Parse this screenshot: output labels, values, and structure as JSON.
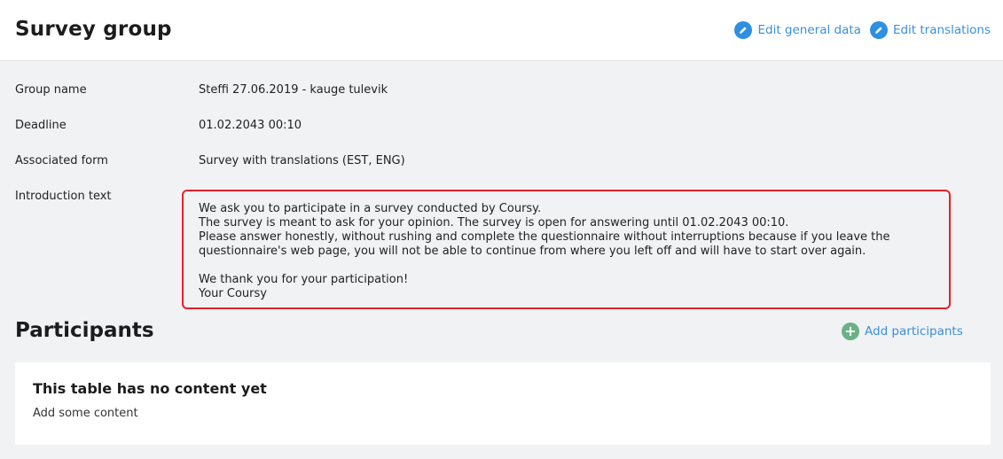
{
  "header": {
    "title": "Survey group",
    "edit_general_label": "Edit general data",
    "edit_translations_label": "Edit translations"
  },
  "details": [
    {
      "label": "Group name",
      "value": "Steffi 27.06.2019 - kauge tulevik"
    },
    {
      "label": "Deadline",
      "value": "01.02.2043 00:10"
    },
    {
      "label": "Associated form",
      "value": "Survey with translations (EST, ENG)"
    },
    {
      "label": "Introduction text",
      "value": ""
    }
  ],
  "intro": {
    "line1": "We ask you to participate in a survey conducted by Coursy.",
    "line2": "The survey is meant to ask for your opinion. The survey is open for answering until 01.02.2043 00:10.",
    "line3": "Please answer honestly, without rushing and complete the questionnaire without interruptions because if you leave the",
    "line4": "questionnaire's web page, you will not be able to continue from where you left off and will have to start over again.",
    "line5": "We thank you for your participation!",
    "line6": "Your Coursy"
  },
  "participants": {
    "title": "Participants",
    "add_label": "Add participants",
    "empty_title": "This table has no content yet",
    "empty_sub": "Add some content"
  },
  "colors": {
    "accent": "#3a8fd8",
    "highlight_border": "#e8202a",
    "add_icon": "#6ab187"
  },
  "icons": {
    "edit": "pencil-icon",
    "add": "plus-icon"
  }
}
